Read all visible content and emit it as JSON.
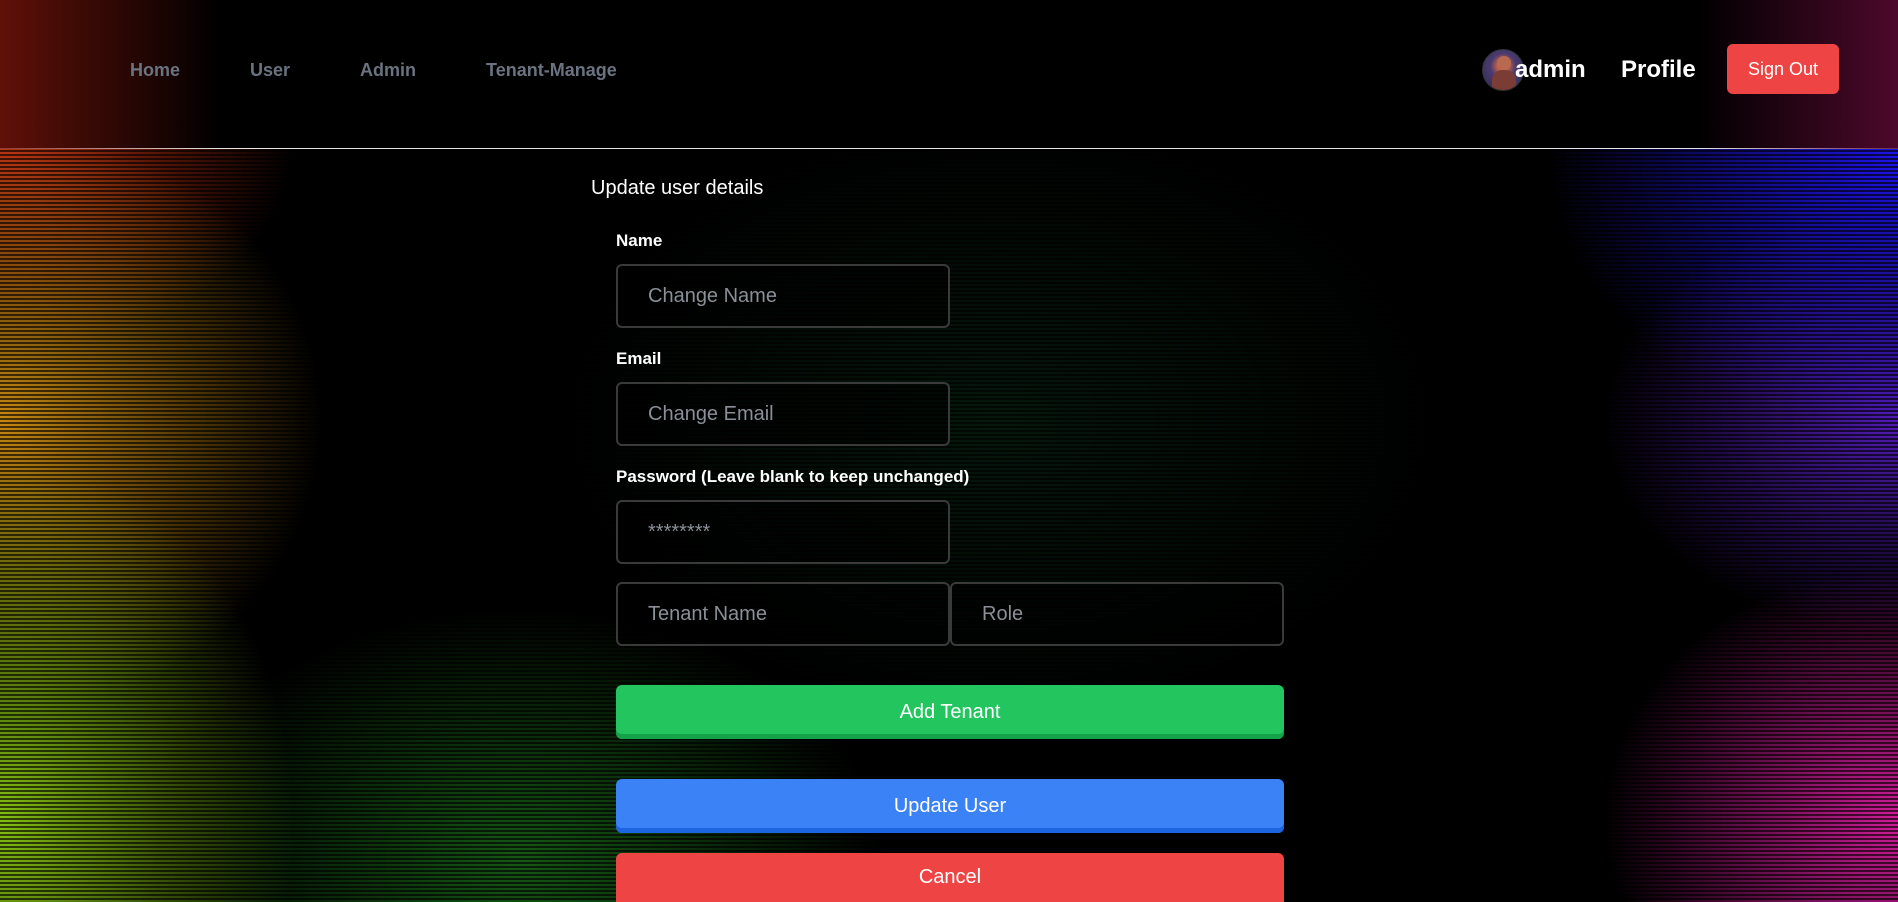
{
  "nav": {
    "items": [
      {
        "label": "Home"
      },
      {
        "label": "User"
      },
      {
        "label": "Admin"
      },
      {
        "label": "Tenant-Manage"
      }
    ]
  },
  "user": {
    "name": "admin",
    "profile_label": "Profile",
    "signout_label": "Sign Out"
  },
  "form": {
    "title": "Update user details",
    "name_label": "Name",
    "name_placeholder": "Change Name",
    "email_label": "Email",
    "email_placeholder": "Change Email",
    "password_label": "Password (Leave blank to keep unchanged)",
    "password_placeholder": "********",
    "tenant_placeholder": "Tenant Name",
    "role_placeholder": "Role",
    "add_tenant_label": "Add Tenant",
    "update_user_label": "Update User",
    "cancel_label": "Cancel"
  },
  "colors": {
    "danger": "#ef4444",
    "success": "#22c55e",
    "primary": "#3b82f6",
    "nav_text": "#6b7280"
  }
}
